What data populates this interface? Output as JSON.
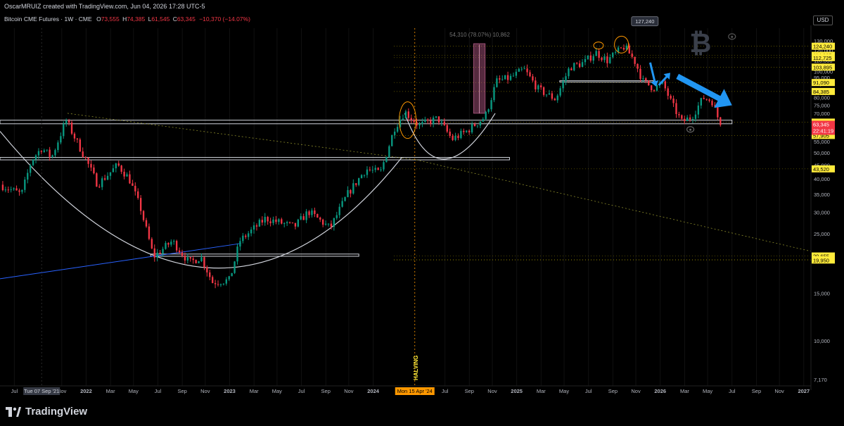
{
  "credit": "OscarMRUIZ created with TradingView.com, Jun 04, 2026 17:28 UTC-5",
  "legend": {
    "symbol": "Bitcoin CME Futures · 1W · CME",
    "o_label": "O",
    "o": "73,555",
    "h_label": "H",
    "h": "74,385",
    "l_label": "L",
    "l": "61,545",
    "c_label": "C",
    "c": "63,345",
    "change": "−10,370 (−14.07%)"
  },
  "currency": "USD",
  "branding": "TradingView",
  "colors": {
    "up": "#089981",
    "down": "#f23645",
    "highlight": "#ffeb3b",
    "accent_blue": "#2196f3",
    "bg": "#000000"
  },
  "icons": [
    "bitcoin-icon",
    "weibo-icon",
    "tradingview-logo-icon"
  ],
  "chart_data": {
    "type": "candlestick",
    "y_scale": "log",
    "y_ticks": [
      {
        "v": 130000,
        "l": "130,000"
      },
      {
        "v": 120000,
        "l": "120,000"
      },
      {
        "v": 110000,
        "l": "110,000"
      },
      {
        "v": 100000,
        "l": "100,000"
      },
      {
        "v": 95000,
        "l": "95,000"
      },
      {
        "v": 90000,
        "l": "90,000"
      },
      {
        "v": 80000,
        "l": "80,000"
      },
      {
        "v": 75000,
        "l": "75,000"
      },
      {
        "v": 70000,
        "l": "70,000"
      },
      {
        "v": 55000,
        "l": "55,000"
      },
      {
        "v": 50000,
        "l": "50,000"
      },
      {
        "v": 45000,
        "l": "45,000"
      },
      {
        "v": 40000,
        "l": "40,000"
      },
      {
        "v": 35000,
        "l": "35,000"
      },
      {
        "v": 30000,
        "l": "30,000"
      },
      {
        "v": 25000,
        "l": "25,000"
      },
      {
        "v": 15000,
        "l": "15,000"
      },
      {
        "v": 10000,
        "l": "10,000"
      },
      {
        "v": 7170,
        "l": "7,170"
      }
    ],
    "price_labels": [
      {
        "v": 124240,
        "l": "124,240"
      },
      {
        "v": 114935,
        "l": "114,935"
      },
      {
        "v": 112725,
        "l": "112,725"
      },
      {
        "v": 103895,
        "l": "103,895"
      },
      {
        "v": 91090,
        "l": "91,090"
      },
      {
        "v": 84385,
        "l": "84,385"
      },
      {
        "v": 64925,
        "l": "64,925"
      },
      {
        "v": 57905,
        "l": "57,905"
      },
      {
        "v": 43520,
        "l": "43,520"
      },
      {
        "v": 20655,
        "l": "20,655"
      },
      {
        "v": 20015,
        "l": "20,015"
      },
      {
        "v": 19950,
        "l": "19,950"
      }
    ],
    "last_price": {
      "v": 63345,
      "l": "63,345",
      "countdown": "22:41:19"
    },
    "x_ticks": [
      {
        "t": 2021.5,
        "l": "Jul"
      },
      {
        "t": 2021.83,
        "l": "Nov"
      },
      {
        "t": 2022.0,
        "l": "2022"
      },
      {
        "t": 2022.17,
        "l": "Mar"
      },
      {
        "t": 2022.33,
        "l": "May"
      },
      {
        "t": 2022.5,
        "l": "Jul"
      },
      {
        "t": 2022.67,
        "l": "Sep"
      },
      {
        "t": 2022.83,
        "l": "Nov"
      },
      {
        "t": 2023.0,
        "l": "2023"
      },
      {
        "t": 2023.17,
        "l": "Mar"
      },
      {
        "t": 2023.33,
        "l": "May"
      },
      {
        "t": 2023.5,
        "l": "Jul"
      },
      {
        "t": 2023.67,
        "l": "Sep"
      },
      {
        "t": 2023.83,
        "l": "Nov"
      },
      {
        "t": 2024.0,
        "l": "2024"
      },
      {
        "t": 2024.5,
        "l": "Jul"
      },
      {
        "t": 2024.67,
        "l": "Sep"
      },
      {
        "t": 2024.83,
        "l": "Nov"
      },
      {
        "t": 2025.0,
        "l": "2025"
      },
      {
        "t": 2025.17,
        "l": "Mar"
      },
      {
        "t": 2025.33,
        "l": "May"
      },
      {
        "t": 2025.5,
        "l": "Jul"
      },
      {
        "t": 2025.67,
        "l": "Sep"
      },
      {
        "t": 2025.83,
        "l": "Nov"
      },
      {
        "t": 2026.0,
        "l": "2026"
      },
      {
        "t": 2026.17,
        "l": "Mar"
      },
      {
        "t": 2026.33,
        "l": "May"
      },
      {
        "t": 2026.5,
        "l": "Jul"
      },
      {
        "t": 2026.67,
        "l": "Sep"
      },
      {
        "t": 2026.83,
        "l": "Nov"
      },
      {
        "t": 2027.0,
        "l": "2027"
      }
    ],
    "cursor_x": {
      "t": 2021.69,
      "l": "Tue 07 Sep '21"
    },
    "halving_date": {
      "t": 2024.29,
      "l": "Mon 15 Apr '24"
    },
    "halving_label": "HALVING",
    "measure_label": "54,310 (78.07%) 10,862",
    "peak_callout": "127,240",
    "xlim": [
      2021.4,
      2027.05
    ],
    "ylim": [
      6800,
      145000
    ],
    "anchors": [
      {
        "t": 2021.4,
        "p": 38000
      },
      {
        "t": 2021.55,
        "p": 35000
      },
      {
        "t": 2021.62,
        "p": 47000
      },
      {
        "t": 2021.69,
        "p": 52000
      },
      {
        "t": 2021.76,
        "p": 48000
      },
      {
        "t": 2021.86,
        "p": 66000
      },
      {
        "t": 2021.92,
        "p": 57000
      },
      {
        "t": 2022.0,
        "p": 47000
      },
      {
        "t": 2022.08,
        "p": 38000
      },
      {
        "t": 2022.22,
        "p": 45000
      },
      {
        "t": 2022.3,
        "p": 40000
      },
      {
        "t": 2022.38,
        "p": 31000
      },
      {
        "t": 2022.47,
        "p": 20500
      },
      {
        "t": 2022.6,
        "p": 23500
      },
      {
        "t": 2022.72,
        "p": 19500
      },
      {
        "t": 2022.8,
        "p": 20500
      },
      {
        "t": 2022.88,
        "p": 16500
      },
      {
        "t": 2023.0,
        "p": 16800
      },
      {
        "t": 2023.07,
        "p": 23500
      },
      {
        "t": 2023.25,
        "p": 28500
      },
      {
        "t": 2023.45,
        "p": 26500
      },
      {
        "t": 2023.55,
        "p": 30200
      },
      {
        "t": 2023.7,
        "p": 26200
      },
      {
        "t": 2023.82,
        "p": 35000
      },
      {
        "t": 2023.95,
        "p": 43500
      },
      {
        "t": 2024.05,
        "p": 42000
      },
      {
        "t": 2024.15,
        "p": 62000
      },
      {
        "t": 2024.22,
        "p": 71000
      },
      {
        "t": 2024.32,
        "p": 63000
      },
      {
        "t": 2024.45,
        "p": 67000
      },
      {
        "t": 2024.55,
        "p": 56000
      },
      {
        "t": 2024.65,
        "p": 60000
      },
      {
        "t": 2024.78,
        "p": 68000
      },
      {
        "t": 2024.86,
        "p": 92000
      },
      {
        "t": 2024.96,
        "p": 95000
      },
      {
        "t": 2025.05,
        "p": 102000
      },
      {
        "t": 2025.15,
        "p": 86000
      },
      {
        "t": 2025.27,
        "p": 79000
      },
      {
        "t": 2025.37,
        "p": 104000
      },
      {
        "t": 2025.47,
        "p": 108000
      },
      {
        "t": 2025.55,
        "p": 118000
      },
      {
        "t": 2025.63,
        "p": 110000
      },
      {
        "t": 2025.75,
        "p": 124000
      },
      {
        "t": 2025.82,
        "p": 110000
      },
      {
        "t": 2025.88,
        "p": 92000
      },
      {
        "t": 2025.95,
        "p": 87000
      },
      {
        "t": 2026.02,
        "p": 90000
      },
      {
        "t": 2026.08,
        "p": 76000
      },
      {
        "t": 2026.15,
        "p": 65000
      },
      {
        "t": 2026.22,
        "p": 68000
      },
      {
        "t": 2026.3,
        "p": 80000
      },
      {
        "t": 2026.36,
        "p": 78000
      },
      {
        "t": 2026.42,
        "p": 63345
      }
    ]
  }
}
